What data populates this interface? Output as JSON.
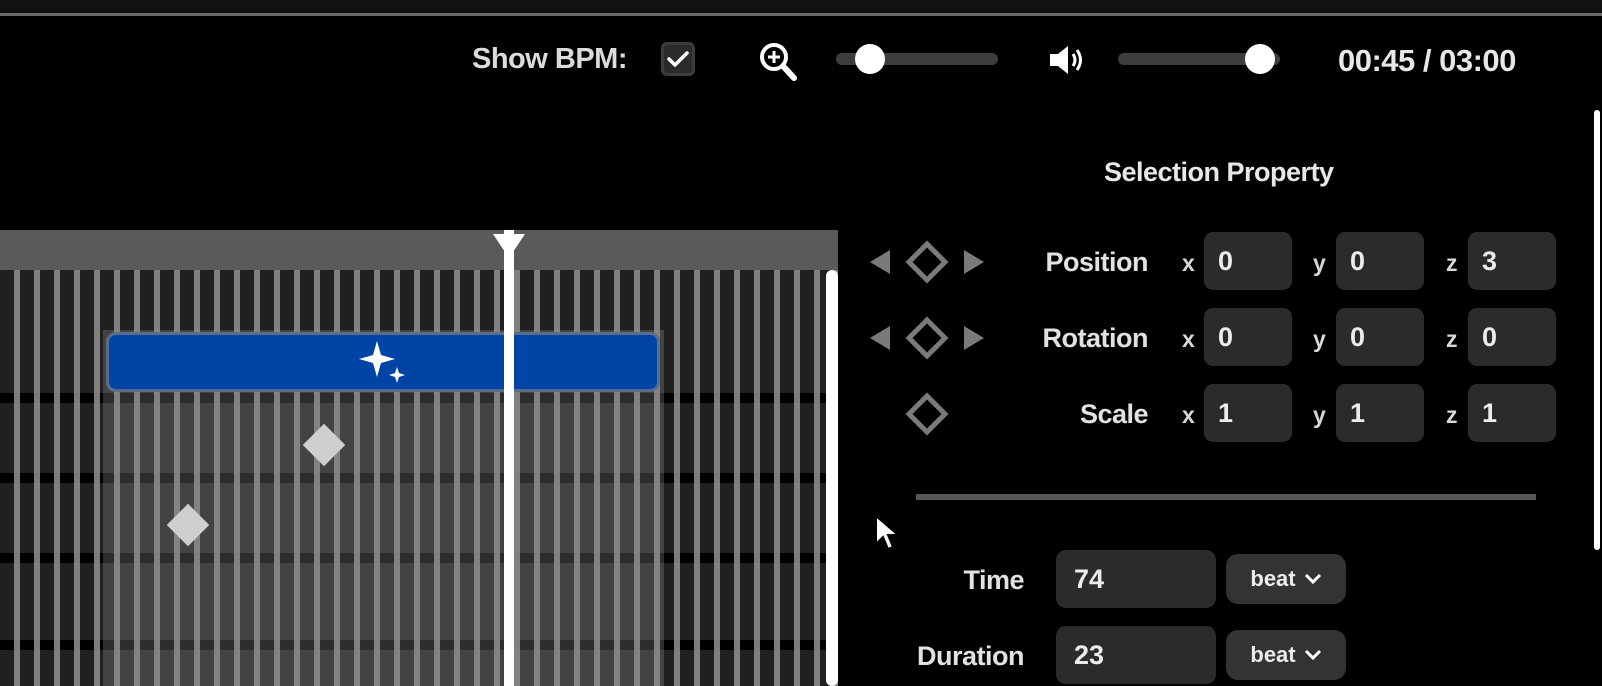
{
  "toolbar": {
    "show_bpm_label": "Show BPM:",
    "show_bpm_checked": true,
    "zoom_icon": "zoom-in-icon",
    "zoom_level": 0.13,
    "volume_icon": "speaker-volume-icon",
    "volume_level": 0.96,
    "time_readout": "00:45 / 03:00"
  },
  "timeline": {
    "playhead_icon": "playhead-marker",
    "clip_icon": "sparkle-icon",
    "keyframe_icon": "keyframe-diamond-icon"
  },
  "selection_panel": {
    "title": "Selection Property",
    "properties": [
      {
        "label": "Position",
        "x": "0",
        "y": "0",
        "z": "3",
        "has_nav": true
      },
      {
        "label": "Rotation",
        "x": "0",
        "y": "0",
        "z": "0",
        "has_nav": true
      },
      {
        "label": "Scale",
        "x": "1",
        "y": "1",
        "z": "1",
        "has_nav": false
      }
    ],
    "axis_labels": {
      "x": "x",
      "y": "y",
      "z": "z"
    },
    "time": {
      "label": "Time",
      "value": "74",
      "unit": "beat"
    },
    "duration": {
      "label": "Duration",
      "value": "23",
      "unit": "beat"
    }
  },
  "colors": {
    "clip": "#0044a6",
    "background": "#000000",
    "field": "#2b2b2b"
  }
}
